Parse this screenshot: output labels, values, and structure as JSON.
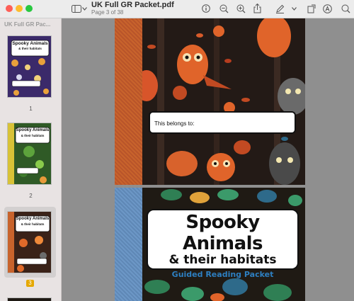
{
  "window": {
    "doc_title": "UK Full GR Packet.pdf",
    "page_status": "Page 3 of 38"
  },
  "toolbar": {
    "icons": [
      "sidebar-icon",
      "chevron-down-icon",
      "info-icon",
      "zoom-out-icon",
      "zoom-in-icon",
      "share-icon",
      "markup-pen-icon",
      "chevron-down-icon",
      "rotate-icon",
      "annotate-circle-icon",
      "search-icon"
    ]
  },
  "sidebar": {
    "title": "UK Full GR Pac...",
    "thumbnails": [
      {
        "number": "1",
        "heading": "Spooky Animals",
        "sub": "& their habitats",
        "color": "#3b2a6a"
      },
      {
        "number": "2",
        "heading": "Spooky Animals",
        "sub": "& their habitats",
        "color": "#2f5a26"
      },
      {
        "number": "3",
        "heading": "Spooky Animals",
        "sub": "& their habitats",
        "color": "#3a2218",
        "selected": true
      }
    ]
  },
  "pages": {
    "page1": {
      "belongs_label": "This belongs to:"
    },
    "page2": {
      "title_line1": "Spooky Animals",
      "title_line2": "& their habitats",
      "title_line3": "Guided Reading Packet"
    }
  },
  "colors": {
    "spine_orange": "#c8632c",
    "spine_blue": "#6c97c6",
    "accent_blue_text": "#2d7fc1",
    "selected_badge": "#e5a800"
  }
}
